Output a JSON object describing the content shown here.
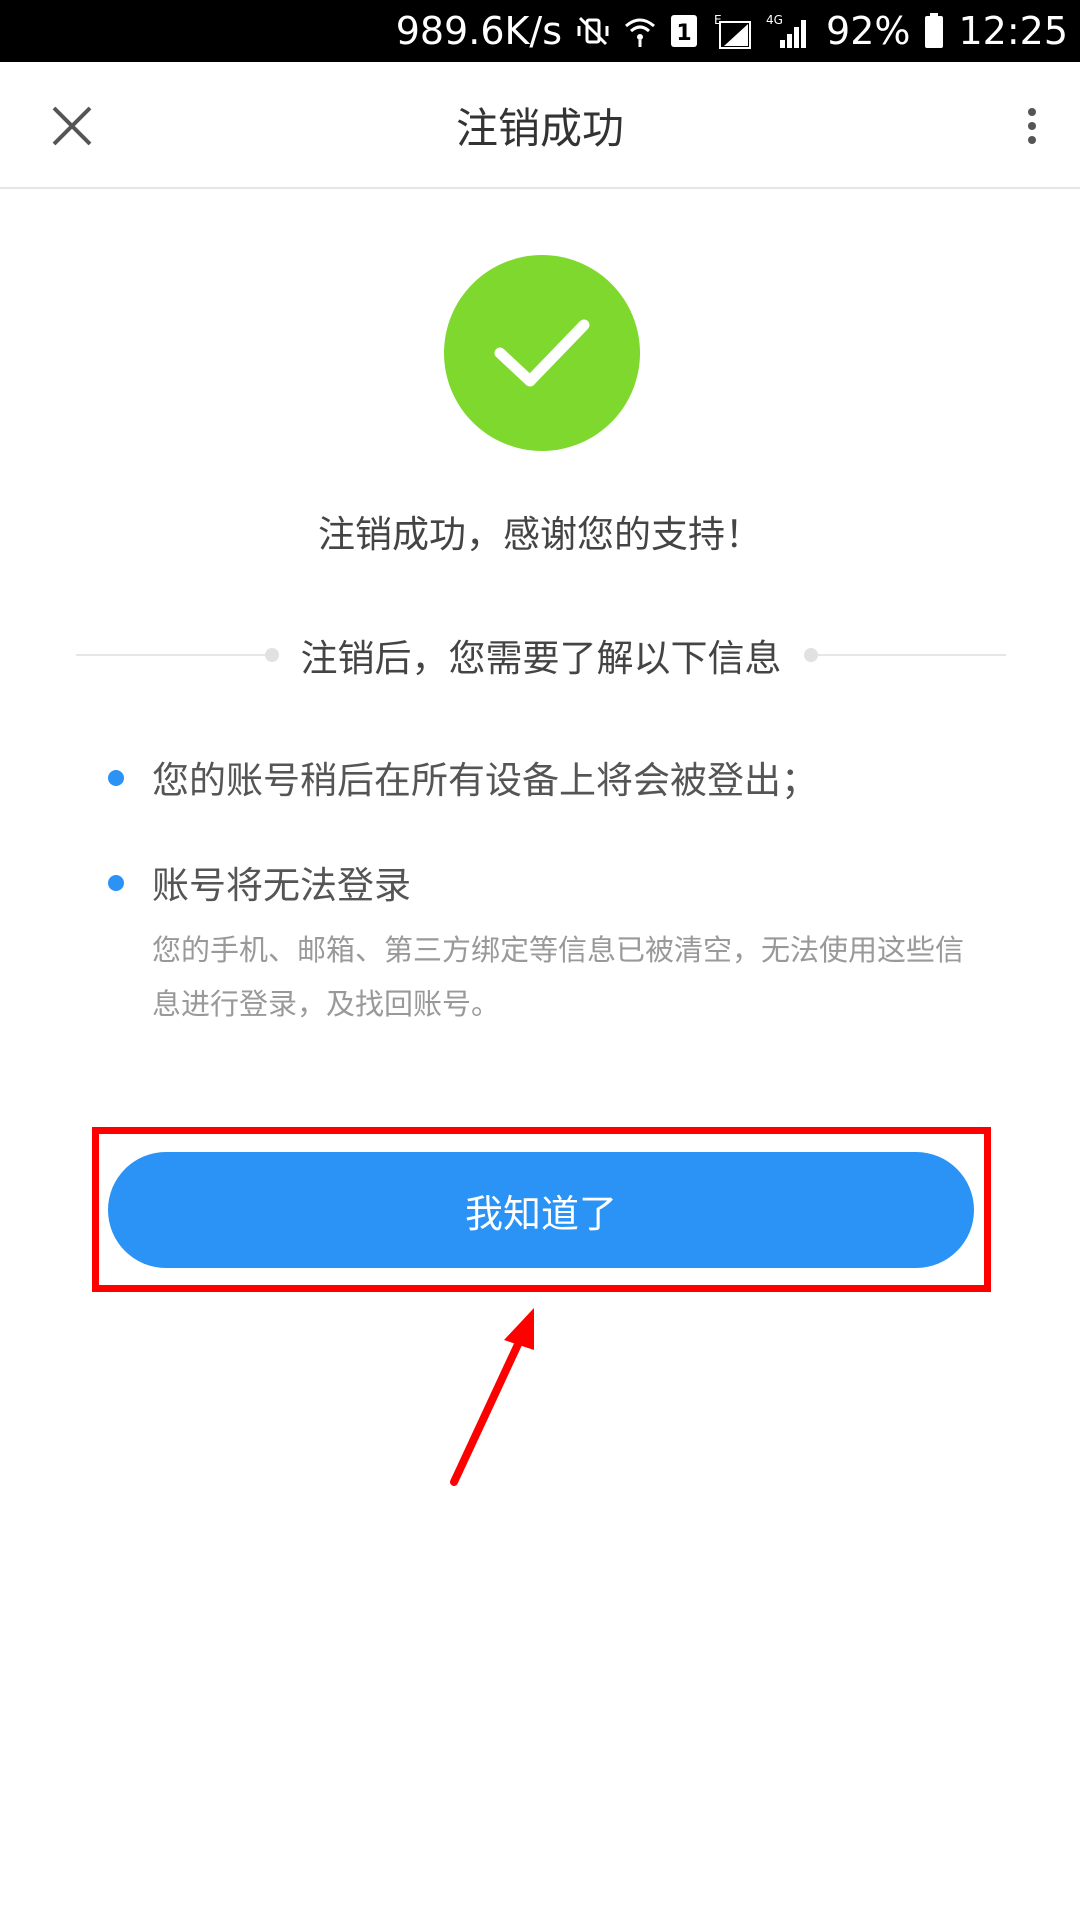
{
  "status_bar": {
    "net_speed": "989.6K/s",
    "sim_badge": "1",
    "network_e": "E",
    "network_4g": "4G",
    "battery": "92%",
    "time": "12:25"
  },
  "header": {
    "title": "注销成功",
    "close_icon": "close-icon",
    "more_icon": "more-vertical-icon"
  },
  "success": {
    "icon": "check-icon",
    "icon_color": "#7ed82d",
    "message": "注销成功，感谢您的支持！"
  },
  "notice": {
    "heading": "注销后，您需要了解以下信息",
    "items": [
      {
        "title": "您的账号稍后在所有设备上将会被登出；",
        "description": ""
      },
      {
        "title": "账号将无法登录",
        "description": "您的手机、邮箱、第三方绑定等信息已被清空，无法使用这些信息进行登录，及找回账号。"
      }
    ]
  },
  "actions": {
    "acknowledge_label": "我知道了",
    "accent_color": "#2b93f6",
    "highlight_color": "#ff0000"
  }
}
